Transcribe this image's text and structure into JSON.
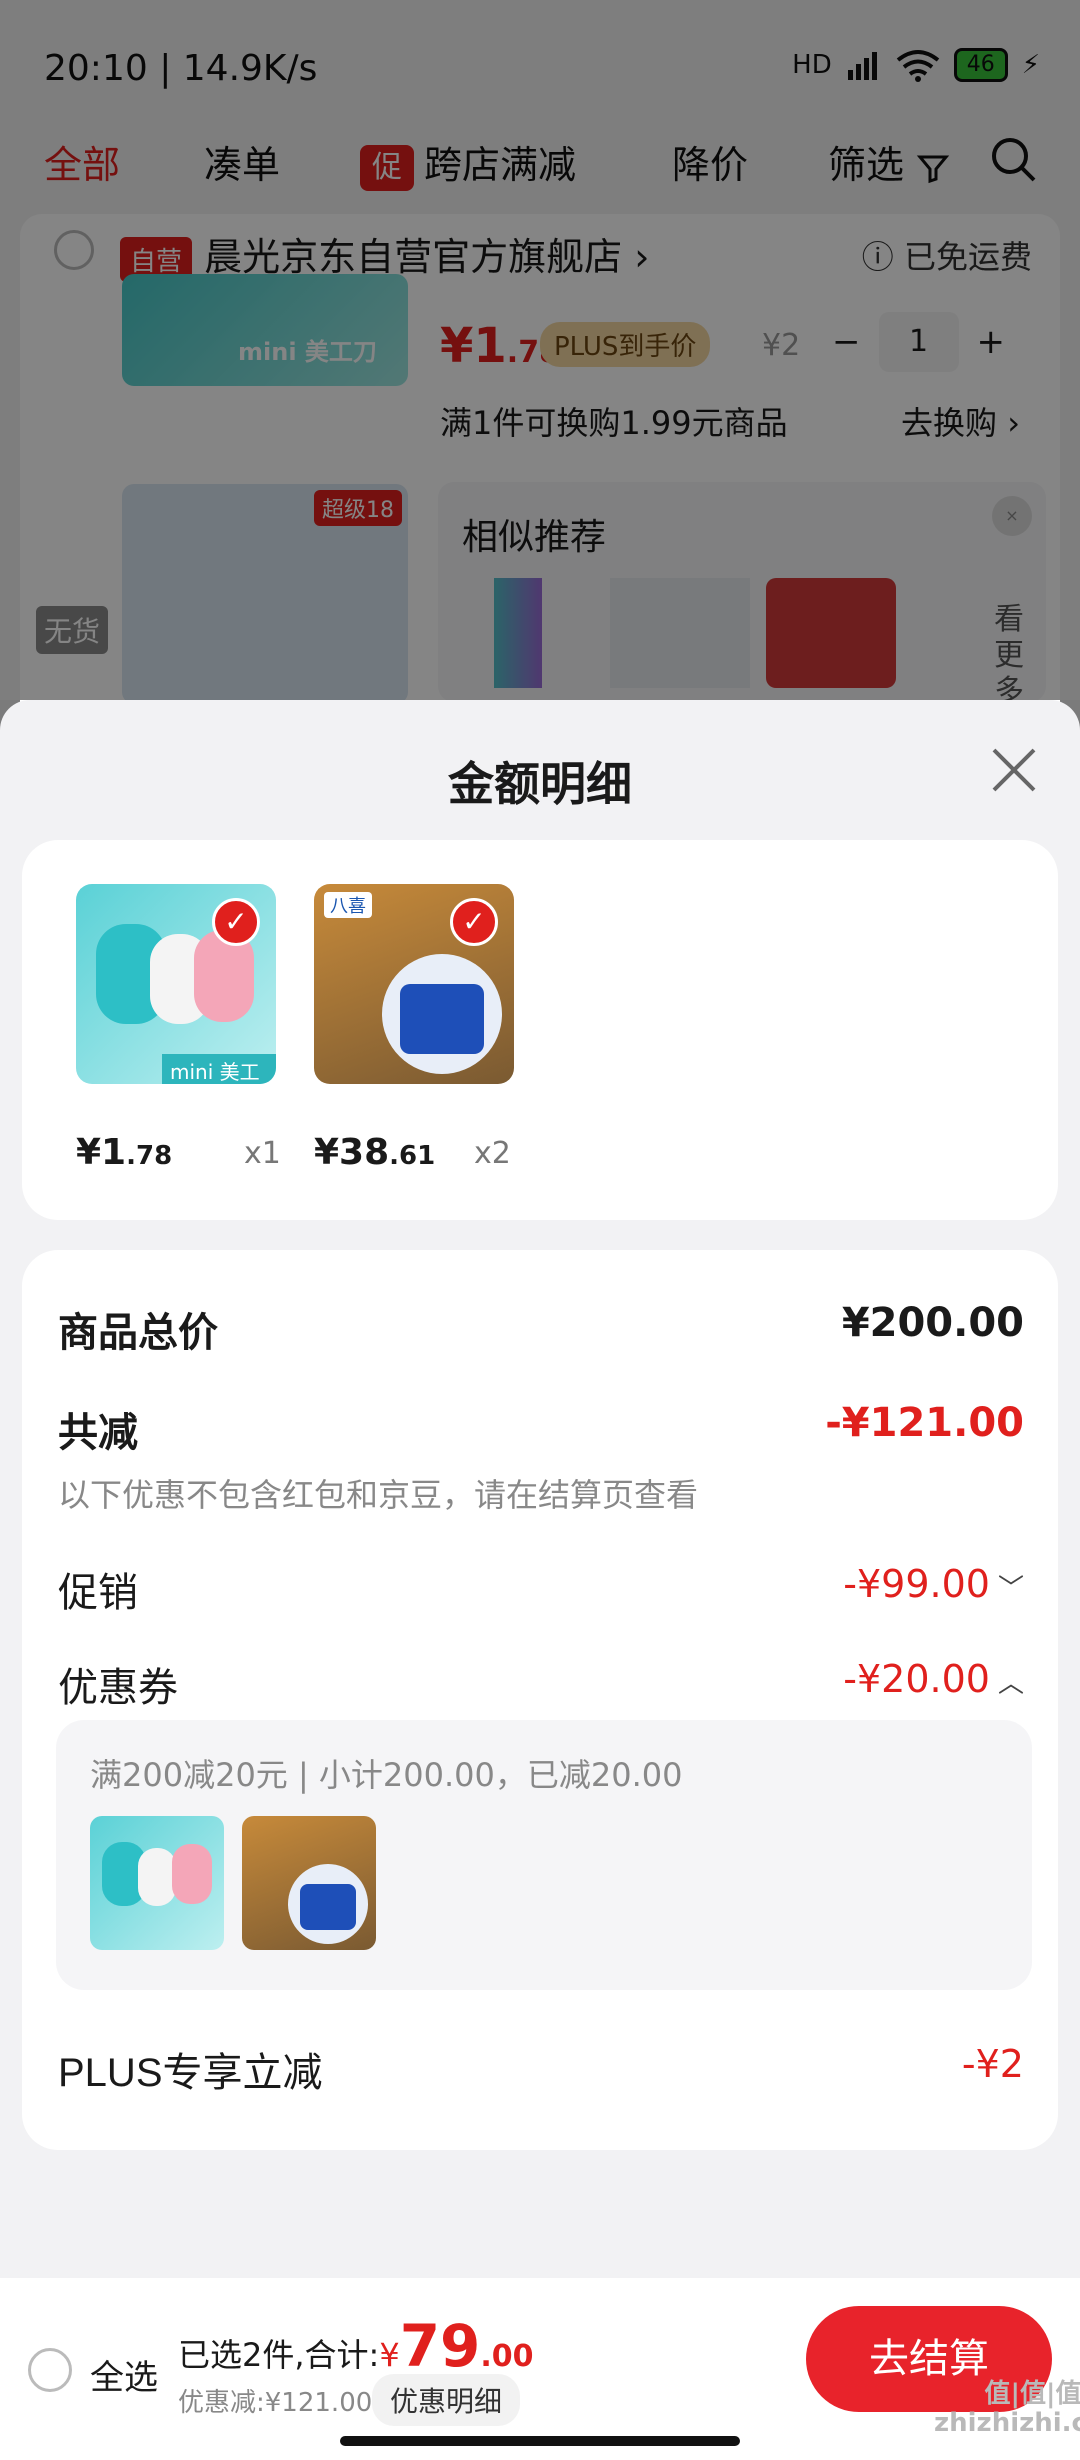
{
  "status_bar": {
    "time": "20:10 | 14.9K/s",
    "signal": "HD",
    "battery": "46"
  },
  "tabs": [
    {
      "label": "全部"
    },
    {
      "label": "凑单"
    },
    {
      "badge": "促",
      "label": "跨店满减"
    },
    {
      "label": "降价"
    },
    {
      "label": "筛选"
    }
  ],
  "store": {
    "self_tag": "自营",
    "name": "晨光京东自营官方旗舰店",
    "shipping": "已免运费",
    "item": {
      "thumb_caption": "mini 美工刀",
      "price_int": "¥1",
      "price_dec": ".78",
      "plus_tag": "PLUS到手价",
      "orig_price": "¥2",
      "qty": "1",
      "exchange_text": "满1件可换购1.99元商品",
      "exchange_link": "去换购"
    },
    "out_of_stock": "无货",
    "badge_super": "超级18",
    "similar_title": "相似推荐",
    "see_more": "看更多"
  },
  "sheet": {
    "title": "金额明细",
    "items": [
      {
        "price_int": "¥1",
        "price_dec": ".78",
        "qty": "x1",
        "caption": "mini 美工刀"
      },
      {
        "price_int": "¥38",
        "price_dec": ".61",
        "qty": "x2",
        "caption": "八喜"
      }
    ],
    "rows": {
      "total_label": "商品总价",
      "total_value": "¥200.00",
      "discount_label": "共减",
      "discount_value": "-¥121.00",
      "discount_note": "以下优惠不包含红包和京豆，请在结算页查看",
      "promo_label": "促销",
      "promo_value": "-¥99.00",
      "coupon_label": "优惠券",
      "coupon_value": "-¥20.00",
      "coupon_desc": "满200减20元 | 小计200.00，已减20.00",
      "plus_label": "PLUS专享立减",
      "plus_value": "-¥2"
    }
  },
  "bottom": {
    "select_all": "全选",
    "selected_text": "已选2件,合计:",
    "currency": "¥",
    "total_int": "79",
    "total_dec": ".00",
    "saved": "优惠减:¥121.00",
    "detail_button": "优惠明细",
    "checkout": "去结算"
  },
  "watermark": "值|值|值 zhizhizhi.com",
  "colors": {
    "accent": "#e0201d",
    "checkout": "#e8232b"
  }
}
